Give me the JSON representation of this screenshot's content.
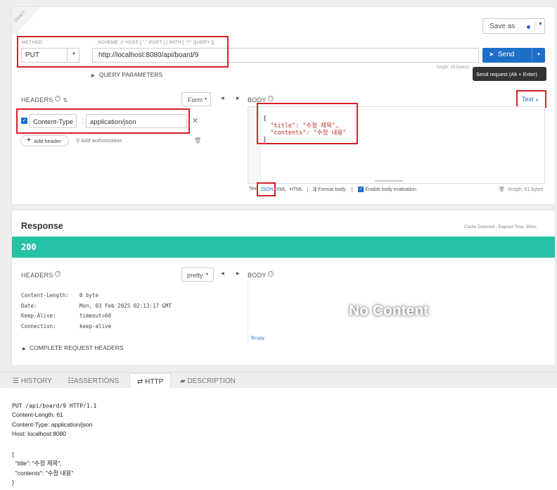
{
  "request": {
    "draft_badge": "DRAFT",
    "save_as_label": "Save as",
    "method_label": "METHOD",
    "method_value": "PUT",
    "scheme_label": "SCHEME :// HOST [ \":\" PORT ] [ PATH [ \"?\" QUERY ]]",
    "url_value": "http://localhost:8080/api/board/9",
    "send_label": "Send",
    "send_tooltip": "Send request (Alt + Enter)",
    "length_info": "length: 33 byte(s)",
    "query_params_label": "QUERY PARAMETERS",
    "headers_label": "HEADERS",
    "headers_mode": "Form",
    "header_rows": [
      {
        "enabled": true,
        "name": "Content-Type",
        "value": "application/json"
      }
    ],
    "add_header_label": "Add header",
    "add_auth_label": "Add authorization",
    "body_label": "BODY",
    "body_type": "Text",
    "body_lines": [
      "{",
      "  \"title\": \"수정 제목\",",
      "  \"contents\": \"수정 내용\"",
      "}"
    ],
    "format_options": [
      "Text",
      "JSON",
      "XML",
      "HTML"
    ],
    "format_body_label": "Format body",
    "enable_eval_label": "Enable body evaluation",
    "body_length": "length: 61 bytes"
  },
  "response": {
    "title": "Response",
    "cache_info": "Cache Detected - Elapsed Time: 56ms",
    "status_code": "200",
    "status_color": "#26c2a6",
    "headers_label": "HEADERS",
    "headers_mode": "pretty",
    "headers": [
      {
        "name": "Content-Length:",
        "value": "0 byte"
      },
      {
        "name": "Date:",
        "value": "Mon, 03 Feb 2025 02:13:17 GMT"
      },
      {
        "name": "Keep-Alive:",
        "value": "timeout=60"
      },
      {
        "name": "Connection:",
        "value": "keep-alive"
      }
    ],
    "complete_headers_label": "COMPLETE REQUEST HEADERS",
    "body_label": "BODY",
    "no_content": "No Content",
    "copy_label": "copy"
  },
  "bottom": {
    "tabs": [
      "HISTORY",
      "ASSERTIONS",
      "HTTP",
      "DESCRIPTION"
    ],
    "active_tab": "HTTP",
    "http_lines": [
      "PUT /api/board/9 HTTP/1.1",
      "Content-Length: 61",
      "Content-Type: application/json",
      "Host: localhost:8080",
      "",
      "{",
      "  \"title\": \"수정 제목\",",
      "  \"contents\": \"수정 내용\"",
      "}"
    ]
  },
  "colors": {
    "accent": "#1e6fc7",
    "status_ok": "#26c2a6",
    "annotation": "#d32029"
  }
}
